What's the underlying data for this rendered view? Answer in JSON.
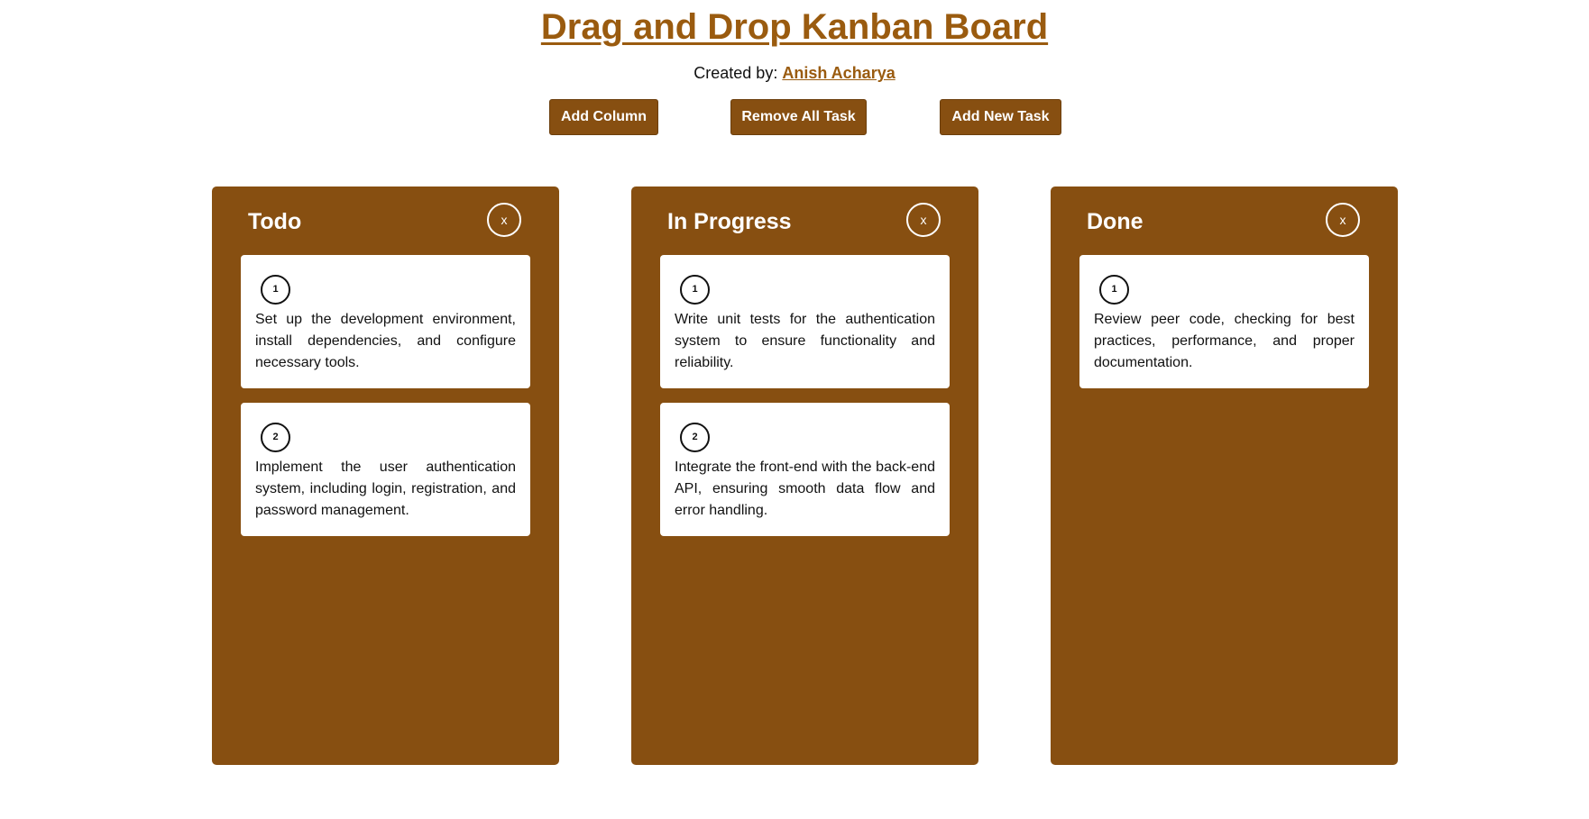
{
  "header": {
    "title": "Drag and Drop Kanban Board",
    "credit_prefix": "Created by:",
    "credit_name": "Anish Acharya"
  },
  "toolbar": {
    "add_column_label": "Add Column",
    "remove_all_label": "Remove All Task",
    "add_task_label": "Add New Task"
  },
  "columns": [
    {
      "title": "Todo",
      "close_label": "x",
      "cards": [
        {
          "number": "1",
          "text": "Set up the development environment, install dependencies, and configure necessary tools."
        },
        {
          "number": "2",
          "text": "Implement the user authentication system, including login, registration, and password management."
        }
      ]
    },
    {
      "title": "In Progress",
      "close_label": "x",
      "cards": [
        {
          "number": "1",
          "text": "Write unit tests for the authentication system to ensure functionality and reliability."
        },
        {
          "number": "2",
          "text": "Integrate the front-end with the back-end API, ensuring smooth data flow and error handling."
        }
      ]
    },
    {
      "title": "Done",
      "close_label": "x",
      "cards": [
        {
          "number": "1",
          "text": "Review peer code, checking for best practices, performance, and proper documentation."
        }
      ]
    }
  ],
  "colors": {
    "accent": "#874f11",
    "title": "#9a5b0f",
    "card_bg": "#ffffff"
  }
}
